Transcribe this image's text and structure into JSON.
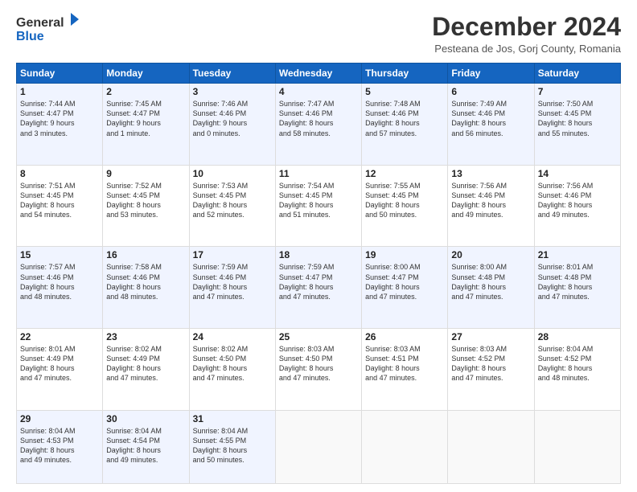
{
  "header": {
    "logo_line1": "General",
    "logo_line2": "Blue",
    "month": "December 2024",
    "location": "Pesteana de Jos, Gorj County, Romania"
  },
  "days_of_week": [
    "Sunday",
    "Monday",
    "Tuesday",
    "Wednesday",
    "Thursday",
    "Friday",
    "Saturday"
  ],
  "weeks": [
    [
      {
        "day": "1",
        "info": "Sunrise: 7:44 AM\nSunset: 4:47 PM\nDaylight: 9 hours\nand 3 minutes."
      },
      {
        "day": "2",
        "info": "Sunrise: 7:45 AM\nSunset: 4:47 PM\nDaylight: 9 hours\nand 1 minute."
      },
      {
        "day": "3",
        "info": "Sunrise: 7:46 AM\nSunset: 4:46 PM\nDaylight: 9 hours\nand 0 minutes."
      },
      {
        "day": "4",
        "info": "Sunrise: 7:47 AM\nSunset: 4:46 PM\nDaylight: 8 hours\nand 58 minutes."
      },
      {
        "day": "5",
        "info": "Sunrise: 7:48 AM\nSunset: 4:46 PM\nDaylight: 8 hours\nand 57 minutes."
      },
      {
        "day": "6",
        "info": "Sunrise: 7:49 AM\nSunset: 4:46 PM\nDaylight: 8 hours\nand 56 minutes."
      },
      {
        "day": "7",
        "info": "Sunrise: 7:50 AM\nSunset: 4:45 PM\nDaylight: 8 hours\nand 55 minutes."
      }
    ],
    [
      {
        "day": "8",
        "info": "Sunrise: 7:51 AM\nSunset: 4:45 PM\nDaylight: 8 hours\nand 54 minutes."
      },
      {
        "day": "9",
        "info": "Sunrise: 7:52 AM\nSunset: 4:45 PM\nDaylight: 8 hours\nand 53 minutes."
      },
      {
        "day": "10",
        "info": "Sunrise: 7:53 AM\nSunset: 4:45 PM\nDaylight: 8 hours\nand 52 minutes."
      },
      {
        "day": "11",
        "info": "Sunrise: 7:54 AM\nSunset: 4:45 PM\nDaylight: 8 hours\nand 51 minutes."
      },
      {
        "day": "12",
        "info": "Sunrise: 7:55 AM\nSunset: 4:45 PM\nDaylight: 8 hours\nand 50 minutes."
      },
      {
        "day": "13",
        "info": "Sunrise: 7:56 AM\nSunset: 4:46 PM\nDaylight: 8 hours\nand 49 minutes."
      },
      {
        "day": "14",
        "info": "Sunrise: 7:56 AM\nSunset: 4:46 PM\nDaylight: 8 hours\nand 49 minutes."
      }
    ],
    [
      {
        "day": "15",
        "info": "Sunrise: 7:57 AM\nSunset: 4:46 PM\nDaylight: 8 hours\nand 48 minutes."
      },
      {
        "day": "16",
        "info": "Sunrise: 7:58 AM\nSunset: 4:46 PM\nDaylight: 8 hours\nand 48 minutes."
      },
      {
        "day": "17",
        "info": "Sunrise: 7:59 AM\nSunset: 4:46 PM\nDaylight: 8 hours\nand 47 minutes."
      },
      {
        "day": "18",
        "info": "Sunrise: 7:59 AM\nSunset: 4:47 PM\nDaylight: 8 hours\nand 47 minutes."
      },
      {
        "day": "19",
        "info": "Sunrise: 8:00 AM\nSunset: 4:47 PM\nDaylight: 8 hours\nand 47 minutes."
      },
      {
        "day": "20",
        "info": "Sunrise: 8:00 AM\nSunset: 4:48 PM\nDaylight: 8 hours\nand 47 minutes."
      },
      {
        "day": "21",
        "info": "Sunrise: 8:01 AM\nSunset: 4:48 PM\nDaylight: 8 hours\nand 47 minutes."
      }
    ],
    [
      {
        "day": "22",
        "info": "Sunrise: 8:01 AM\nSunset: 4:49 PM\nDaylight: 8 hours\nand 47 minutes."
      },
      {
        "day": "23",
        "info": "Sunrise: 8:02 AM\nSunset: 4:49 PM\nDaylight: 8 hours\nand 47 minutes."
      },
      {
        "day": "24",
        "info": "Sunrise: 8:02 AM\nSunset: 4:50 PM\nDaylight: 8 hours\nand 47 minutes."
      },
      {
        "day": "25",
        "info": "Sunrise: 8:03 AM\nSunset: 4:50 PM\nDaylight: 8 hours\nand 47 minutes."
      },
      {
        "day": "26",
        "info": "Sunrise: 8:03 AM\nSunset: 4:51 PM\nDaylight: 8 hours\nand 47 minutes."
      },
      {
        "day": "27",
        "info": "Sunrise: 8:03 AM\nSunset: 4:52 PM\nDaylight: 8 hours\nand 47 minutes."
      },
      {
        "day": "28",
        "info": "Sunrise: 8:04 AM\nSunset: 4:52 PM\nDaylight: 8 hours\nand 48 minutes."
      }
    ],
    [
      {
        "day": "29",
        "info": "Sunrise: 8:04 AM\nSunset: 4:53 PM\nDaylight: 8 hours\nand 49 minutes."
      },
      {
        "day": "30",
        "info": "Sunrise: 8:04 AM\nSunset: 4:54 PM\nDaylight: 8 hours\nand 49 minutes."
      },
      {
        "day": "31",
        "info": "Sunrise: 8:04 AM\nSunset: 4:55 PM\nDaylight: 8 hours\nand 50 minutes."
      },
      {
        "day": "",
        "info": ""
      },
      {
        "day": "",
        "info": ""
      },
      {
        "day": "",
        "info": ""
      },
      {
        "day": "",
        "info": ""
      }
    ]
  ]
}
